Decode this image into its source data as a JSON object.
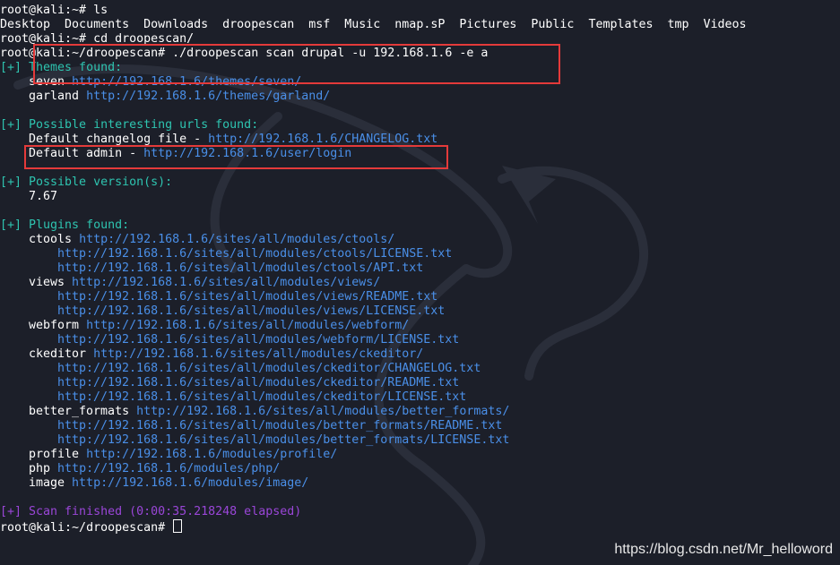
{
  "terminal": {
    "prompt_home": "root@kali:~#",
    "prompt_droopescan": "root@kali:~/droopescan#",
    "cmd_ls": "ls",
    "ls_output": "Desktop  Documents  Downloads  droopescan  msf  Music  nmap.sP  Pictures  Public  Templates  tmp  Videos",
    "cmd_cd": "cd droopescan/",
    "cmd_scan": "./droopescan scan drupal -u 192.168.1.6 -e a",
    "themes_header": "[+] Themes found:",
    "themes": [
      {
        "name": "seven",
        "url": "http://192.168.1.6/themes/seven/"
      },
      {
        "name": "garland",
        "url": "http://192.168.1.6/themes/garland/"
      }
    ],
    "urls_header": "[+] Possible interesting urls found:",
    "interesting_urls": [
      {
        "label": "Default changelog file - ",
        "url": "http://192.168.1.6/CHANGELOG.txt"
      },
      {
        "label": "Default admin - ",
        "url": "http://192.168.1.6/user/login"
      }
    ],
    "version_header": "[+] Possible version(s):",
    "version": "7.67",
    "plugins_header": "[+] Plugins found:",
    "plugins": [
      {
        "name": "ctools",
        "url": "http://192.168.1.6/sites/all/modules/ctools/",
        "files": [
          "http://192.168.1.6/sites/all/modules/ctools/LICENSE.txt",
          "http://192.168.1.6/sites/all/modules/ctools/API.txt"
        ]
      },
      {
        "name": "views",
        "url": "http://192.168.1.6/sites/all/modules/views/",
        "files": [
          "http://192.168.1.6/sites/all/modules/views/README.txt",
          "http://192.168.1.6/sites/all/modules/views/LICENSE.txt"
        ]
      },
      {
        "name": "webform",
        "url": "http://192.168.1.6/sites/all/modules/webform/",
        "files": [
          "http://192.168.1.6/sites/all/modules/webform/LICENSE.txt"
        ]
      },
      {
        "name": "ckeditor",
        "url": "http://192.168.1.6/sites/all/modules/ckeditor/",
        "files": [
          "http://192.168.1.6/sites/all/modules/ckeditor/CHANGELOG.txt",
          "http://192.168.1.6/sites/all/modules/ckeditor/README.txt",
          "http://192.168.1.6/sites/all/modules/ckeditor/LICENSE.txt"
        ]
      },
      {
        "name": "better_formats",
        "url": "http://192.168.1.6/sites/all/modules/better_formats/",
        "files": [
          "http://192.168.1.6/sites/all/modules/better_formats/README.txt",
          "http://192.168.1.6/sites/all/modules/better_formats/LICENSE.txt"
        ]
      },
      {
        "name": "profile",
        "url": "http://192.168.1.6/modules/profile/",
        "files": []
      },
      {
        "name": "php",
        "url": "http://192.168.1.6/modules/php/",
        "files": []
      },
      {
        "name": "image",
        "url": "http://192.168.1.6/modules/image/",
        "files": []
      }
    ],
    "scan_finished": "[+] Scan finished (0:00:35.218248 elapsed)"
  },
  "watermark": "https://blog.csdn.net/Mr_helloword",
  "colors": {
    "background": "#1c1f29",
    "url": "#4a8fe8",
    "section_header": "#2ec4b0",
    "scan_finished": "#9a46d8",
    "highlight_box": "#e43a3a"
  }
}
